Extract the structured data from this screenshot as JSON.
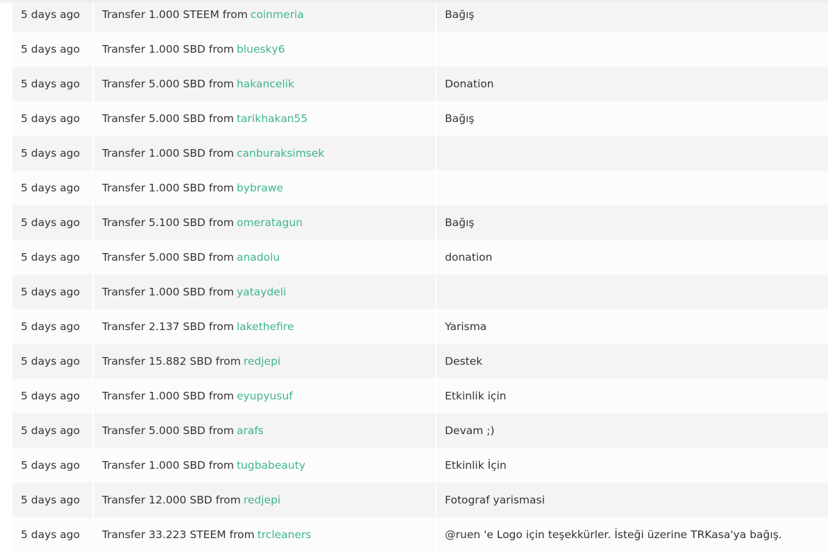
{
  "rows": [
    {
      "time": "5 days ago",
      "action": "Transfer 1.000 STEEM from",
      "user": "coinmeria",
      "memo": "Bağış"
    },
    {
      "time": "5 days ago",
      "action": "Transfer 1.000 SBD from",
      "user": "blueskу6",
      "memo": ""
    },
    {
      "time": "5 days ago",
      "action": "Transfer 5.000 SBD from",
      "user": "hakancelik",
      "memo": "Donation"
    },
    {
      "time": "5 days ago",
      "action": "Transfer 5.000 SBD from",
      "user": "tarikhakan55",
      "memo": "Bağış"
    },
    {
      "time": "5 days ago",
      "action": "Transfer 1.000 SBD from",
      "user": "canburaksimsek",
      "memo": ""
    },
    {
      "time": "5 days ago",
      "action": "Transfer 1.000 SBD from",
      "user": "bybrawe",
      "memo": ""
    },
    {
      "time": "5 days ago",
      "action": "Transfer 5.100 SBD from",
      "user": "omeratagun",
      "memo": "Bağış"
    },
    {
      "time": "5 days ago",
      "action": "Transfer 5.000 SBD from",
      "user": "anadolu",
      "memo": "donation"
    },
    {
      "time": "5 days ago",
      "action": "Transfer 1.000 SBD from",
      "user": "yataydeli",
      "memo": ""
    },
    {
      "time": "5 days ago",
      "action": "Transfer 2.137 SBD from",
      "user": "lakethefire",
      "memo": "Yarisma"
    },
    {
      "time": "5 days ago",
      "action": "Transfer 15.882 SBD from",
      "user": "redjepi",
      "memo": "Destek"
    },
    {
      "time": "5 days ago",
      "action": "Transfer 1.000 SBD from",
      "user": "eyupyusuf",
      "memo": "Etkinlik için"
    },
    {
      "time": "5 days ago",
      "action": "Transfer 5.000 SBD from",
      "user": "arafs",
      "memo": "Devam ;)"
    },
    {
      "time": "5 days ago",
      "action": "Transfer 1.000 SBD from",
      "user": "tugbabeauty",
      "memo": "Etkinlik İçin"
    },
    {
      "time": "5 days ago",
      "action": "Transfer 12.000 SBD from",
      "user": "redjepi",
      "memo": "Fotograf yarismasi"
    },
    {
      "time": "5 days ago",
      "action": "Transfer 33.223 STEEM from",
      "user": "trcleaners",
      "memo": "@ruen 'e Logo için teşekkürler. İsteği üzerine TRKasa'ya bağış."
    }
  ],
  "colors": {
    "link": "#3eb48f",
    "row_odd": "#f4f4f4",
    "row_even": "#fcfcfc",
    "text": "#333333"
  }
}
